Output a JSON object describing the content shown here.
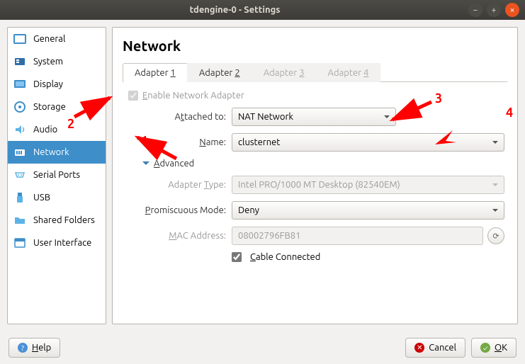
{
  "window": {
    "title": "tdengine-0 - Settings"
  },
  "sidebar": {
    "items": [
      {
        "label": "General"
      },
      {
        "label": "System"
      },
      {
        "label": "Display"
      },
      {
        "label": "Storage"
      },
      {
        "label": "Audio"
      },
      {
        "label": "Network"
      },
      {
        "label": "Serial Ports"
      },
      {
        "label": "USB"
      },
      {
        "label": "Shared Folders"
      },
      {
        "label": "User Interface"
      }
    ]
  },
  "header": {
    "title": "Network"
  },
  "tabs": [
    {
      "label_prefix": "Adapter ",
      "num": "1"
    },
    {
      "label_prefix": "Adapter ",
      "num": "2"
    },
    {
      "label_prefix": "Adapter ",
      "num": "3"
    },
    {
      "label_prefix": "Adapter ",
      "num": "4"
    }
  ],
  "form": {
    "enable_label": "Enable Network Adapter",
    "attached_label_pre": "A",
    "attached_label_u": "t",
    "attached_label_post": "tached to:",
    "attached_value": "NAT Network",
    "name_label_u": "N",
    "name_label_post": "ame:",
    "name_value": "clusternet",
    "advanced_label_u": "A",
    "advanced_label_post": "dvanced",
    "type_label_pre": "Adapter ",
    "type_label_u": "T",
    "type_label_post": "ype:",
    "type_value": "Intel PRO/1000 MT Desktop (82540EM)",
    "promisc_label_u": "P",
    "promisc_label_post": "romiscuous Mode:",
    "promisc_value": "Deny",
    "mac_label_u": "M",
    "mac_label_post": "AC Address:",
    "mac_value": "08002796FB81",
    "cable_label_u": "C",
    "cable_label_post": "able Connected"
  },
  "footer": {
    "help": "Help",
    "cancel": "Cancel",
    "ok": "OK"
  },
  "annotations": {
    "a1": "1",
    "a2": "2",
    "a3": "3",
    "a4": "4"
  }
}
